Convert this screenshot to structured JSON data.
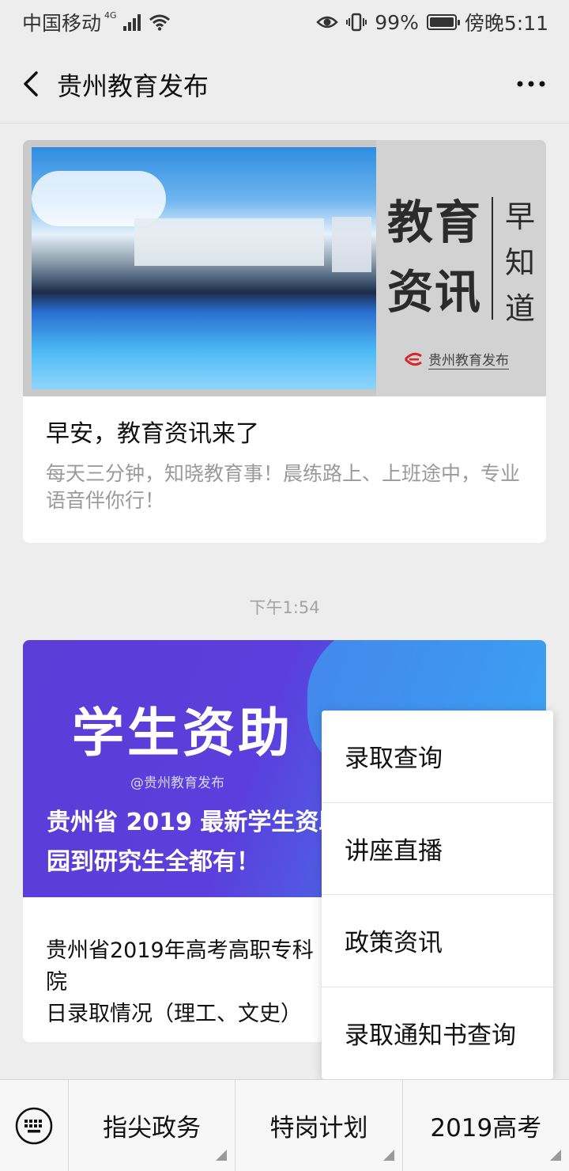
{
  "status_bar": {
    "carrier": "中国移动",
    "network": "4G",
    "battery": "99%",
    "time": "傍晚5:11"
  },
  "header": {
    "title": "贵州教育发布"
  },
  "messages": {
    "card1": {
      "cover_main": "教育\n资讯",
      "cover_vertical": "早\n知\n道",
      "cover_logo_text": "贵州教育发布",
      "title": "早安，教育资讯来了",
      "description": "每天三分钟，知晓教育事！晨练路上、上班途中，专业语音伴你行！"
    },
    "timestamp": "下午1:54",
    "card2": {
      "cover_title": "学生资助",
      "cover_at": "@贵州教育发布",
      "cover_subtitle": "贵州省 2019 最新学生资助\n园到研究生全都有！",
      "title": "贵州省2019年高考高职专科院\n日录取情况（理工、文史）"
    }
  },
  "popup_menu": {
    "items": [
      "录取查询",
      "讲座直播",
      "政策资讯",
      "录取通知书查询"
    ]
  },
  "bottom_menu": {
    "items": [
      "指尖政务",
      "特岗计划",
      "2019高考"
    ]
  }
}
